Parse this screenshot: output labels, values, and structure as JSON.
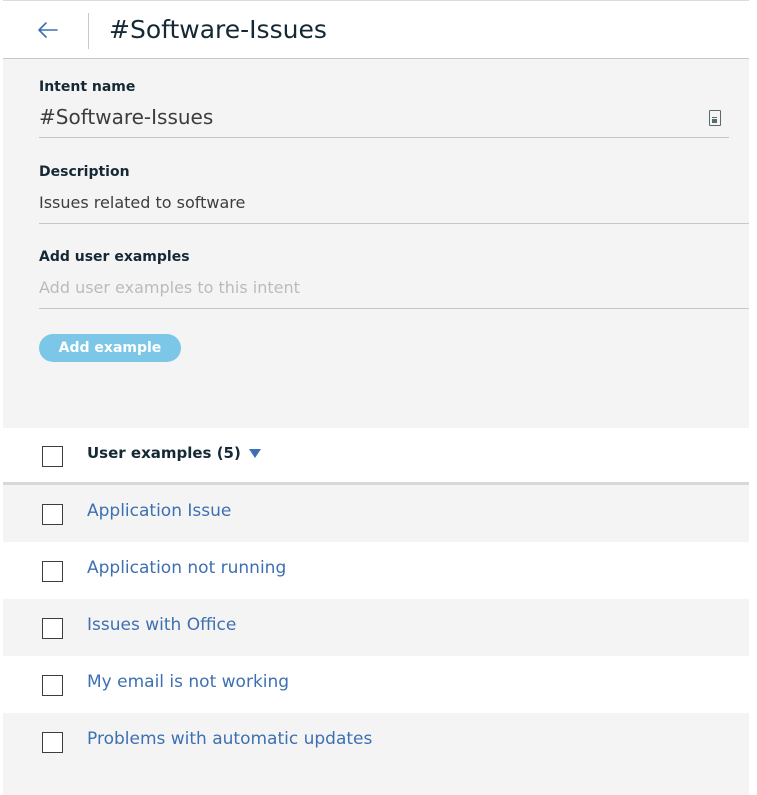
{
  "header": {
    "title": "#Software-Issues"
  },
  "form": {
    "intent_name_label": "Intent name",
    "intent_name_value": "#Software-Issues",
    "description_label": "Description",
    "description_value": "Issues related to software",
    "examples_label": "Add user examples",
    "examples_placeholder": "Add user examples to this intent",
    "add_button_label": "Add example"
  },
  "table": {
    "header_label": "User examples (5)",
    "rows": [
      {
        "text": "Application Issue"
      },
      {
        "text": "Application not running"
      },
      {
        "text": "Issues with Office"
      },
      {
        "text": "My email is not working"
      },
      {
        "text": "Problems with automatic updates"
      }
    ]
  },
  "colors": {
    "accent": "#3d70b2",
    "button": "#7cc7e8",
    "panel": "#f4f4f4"
  },
  "icons": {
    "back": "arrow-left-icon",
    "field": "document-icon",
    "sort": "caret-down-icon"
  }
}
